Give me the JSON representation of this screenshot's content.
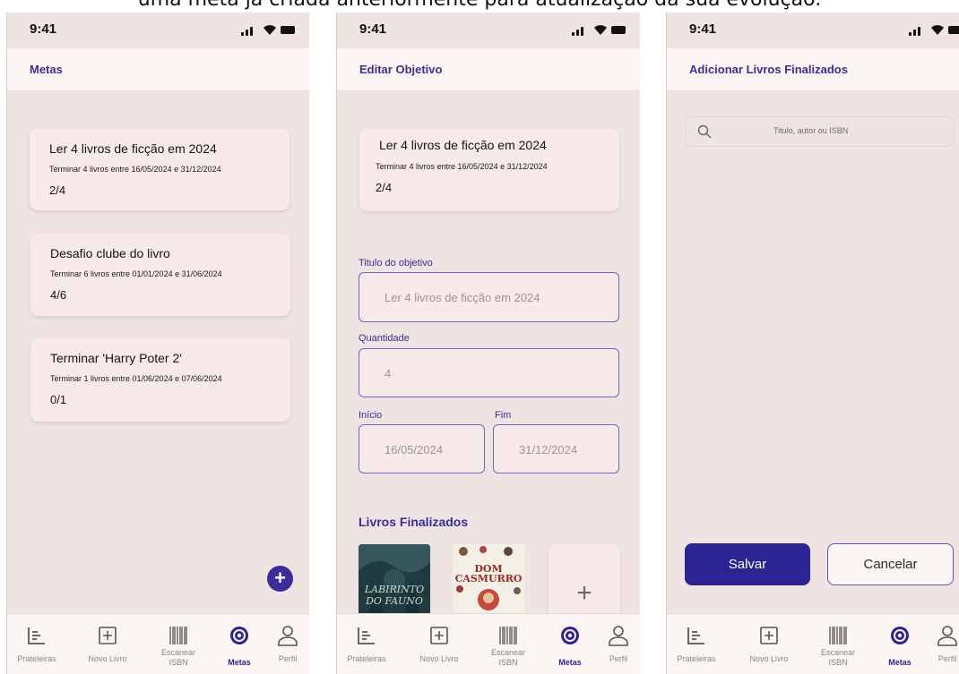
{
  "caption": "uma meta já criada anteriormente para atualização da sua evolução.",
  "status": {
    "time": "9:41"
  },
  "colors": {
    "accent": "#3a2d9c",
    "button": "#2d2494",
    "background": "#efe4e2",
    "card": "#f8eae9"
  },
  "screen1": {
    "title": "Metas",
    "goals": [
      {
        "title": "Ler 4 livros de ficção em 2024",
        "desc": "Terminar 4 livros entre 16/05/2024 e 31/12/2024",
        "progress": "2/4"
      },
      {
        "title": "Desafio clube do livro",
        "desc": "Terminar 6 livros entre 01/01/2024 e 31/06/2024",
        "progress": "4/6"
      },
      {
        "title": "Terminar  'Harry Poter 2'",
        "desc": "Terminar 1 livros entre 01/06/2024 e 07/06/2024",
        "progress": "0/1"
      }
    ],
    "fab": "+"
  },
  "screen2": {
    "title": "Editar Objetivo",
    "goal": {
      "title": "Ler 4 livros de ficção em 2024",
      "desc": "Terminar 4 livros entre 16/05/2024 e 31/12/2024",
      "progress": "2/4"
    },
    "fields": {
      "title_label": "Titulo do objetivo",
      "title_value": "Ler 4 livros de ficção em 2024",
      "quantity_label": "Quantidade",
      "quantity_value": "4",
      "start_label": "Início",
      "start_value": "16/05/2024",
      "end_label": "Fim",
      "end_value": "31/12/2024"
    },
    "finished_title": "Livros Finalizados",
    "books": [
      {
        "title": "LABIRINTO DO FAUNO",
        "icon": "book-cover-labirinto"
      },
      {
        "title": "DOM CASMURRO",
        "icon": "book-cover-dom-casmurro"
      }
    ],
    "add_book": "+"
  },
  "screen3": {
    "title": "Adicionar Livros Finalizados",
    "search_placeholder": "Titulo, autor ou ISBN",
    "save": "Salvar",
    "cancel": "Cancelar"
  },
  "tabs": [
    {
      "label": "Prateleiras",
      "icon": "shelves-icon"
    },
    {
      "label": "Novo Livro",
      "icon": "add-book-icon"
    },
    {
      "label": "Escanear ISBN",
      "icon": "barcode-icon"
    },
    {
      "label": "Metas",
      "icon": "target-icon",
      "active": true
    },
    {
      "label": "Perfil",
      "icon": "profile-icon"
    }
  ]
}
